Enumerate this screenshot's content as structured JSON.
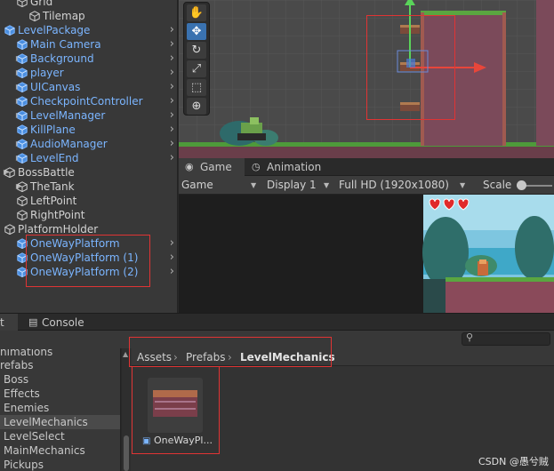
{
  "hierarchy": {
    "items": [
      {
        "label": "Grid",
        "kind": "plain"
      },
      {
        "label": "Tilemap",
        "kind": "plain"
      },
      {
        "label": "LevelPackage",
        "kind": "prefab"
      },
      {
        "label": "Main Camera",
        "kind": "prefab"
      },
      {
        "label": "Background",
        "kind": "prefab"
      },
      {
        "label": "player",
        "kind": "prefab"
      },
      {
        "label": "UICanvas",
        "kind": "prefab"
      },
      {
        "label": "CheckpointController",
        "kind": "prefab"
      },
      {
        "label": "LevelManager",
        "kind": "prefab"
      },
      {
        "label": "KillPlane",
        "kind": "prefab"
      },
      {
        "label": "AudioManager",
        "kind": "prefab"
      },
      {
        "label": "LevelEnd",
        "kind": "prefab"
      },
      {
        "label": "BossBattle",
        "kind": "plain"
      },
      {
        "label": "TheTank",
        "kind": "plain"
      },
      {
        "label": "LeftPoint",
        "kind": "plain"
      },
      {
        "label": "RightPoint",
        "kind": "plain"
      },
      {
        "label": "PlatformHolder",
        "kind": "plain"
      },
      {
        "label": "OneWayPlatform",
        "kind": "prefab"
      },
      {
        "label": "OneWayPlatform (1)",
        "kind": "prefab"
      },
      {
        "label": "OneWayPlatform (2)",
        "kind": "prefab"
      }
    ]
  },
  "scene": {
    "tools": [
      "hand-tool-icon",
      "move-tool-icon",
      "rotate-tool-icon",
      "scale-tool-icon",
      "rect-tool-icon",
      "transform-tool-icon"
    ],
    "active_tool": "move-tool-icon"
  },
  "game_tabs": {
    "game": "Game",
    "animation": "Animation"
  },
  "game_bar": {
    "display_mode": "Game",
    "display": "Display 1",
    "resolution": "Full HD (1920x1080)",
    "scale_label": "Scale"
  },
  "bottom_tabs": {
    "project_partial": "t",
    "console": "Console"
  },
  "project": {
    "folders": [
      "nimations",
      "refabs",
      "Boss",
      "Effects",
      "Enemies",
      "LevelMechanics",
      "LevelSelect",
      "MainMechanics",
      "Pickups"
    ],
    "selected_folder": "LevelMechanics",
    "breadcrumb": [
      "Assets",
      "Prefabs",
      "LevelMechanics"
    ],
    "asset_label": "OneWayPl..."
  },
  "colors": {
    "prefab_blue": "#7bb5ff",
    "highlight_red": "#e03434",
    "selection_blue": "#3a72b0"
  },
  "watermark": "CSDN @愚兮贼"
}
